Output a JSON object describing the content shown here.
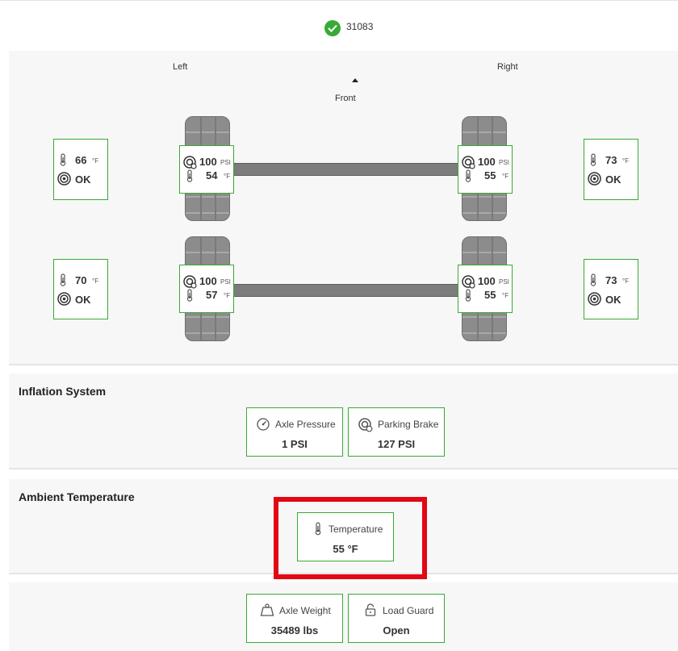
{
  "header": {
    "unit_id": "31083",
    "status": "ok"
  },
  "diagram": {
    "left_label": "Left",
    "right_label": "Right",
    "front_label": "Front",
    "axles": [
      {
        "outer_left": {
          "temp": "66",
          "temp_unit": "°F",
          "status": "OK"
        },
        "inner_left": {
          "pressure": "100",
          "pressure_unit": "PSI",
          "temp": "54",
          "temp_unit": "°F"
        },
        "inner_right": {
          "pressure": "100",
          "pressure_unit": "PSI",
          "temp": "55",
          "temp_unit": "°F"
        },
        "outer_right": {
          "temp": "73",
          "temp_unit": "°F",
          "status": "OK"
        }
      },
      {
        "outer_left": {
          "temp": "70",
          "temp_unit": "°F",
          "status": "OK"
        },
        "inner_left": {
          "pressure": "100",
          "pressure_unit": "PSI",
          "temp": "57",
          "temp_unit": "°F"
        },
        "inner_right": {
          "pressure": "100",
          "pressure_unit": "PSI",
          "temp": "55",
          "temp_unit": "°F"
        },
        "outer_right": {
          "temp": "73",
          "temp_unit": "°F",
          "status": "OK"
        }
      }
    ]
  },
  "inflation": {
    "title": "Inflation System",
    "axle_pressure": {
      "label": "Axle Pressure",
      "value": "1 PSI",
      "icon": "gauge-icon"
    },
    "parking_brake": {
      "label": "Parking Brake",
      "value": "127 PSI",
      "icon": "brake-icon"
    }
  },
  "ambient": {
    "title": "Ambient Temperature",
    "temperature": {
      "label": "Temperature",
      "value": "55 °F",
      "icon": "thermometer-icon"
    }
  },
  "bottom": {
    "axle_weight": {
      "label": "Axle Weight",
      "value": "35489 lbs",
      "icon": "weight-icon"
    },
    "load_guard": {
      "label": "Load Guard",
      "value": "Open",
      "icon": "unlock-icon"
    }
  },
  "colors": {
    "accent": "#3aa935",
    "highlight": "#e30613",
    "panel": "#f7f7f7"
  }
}
